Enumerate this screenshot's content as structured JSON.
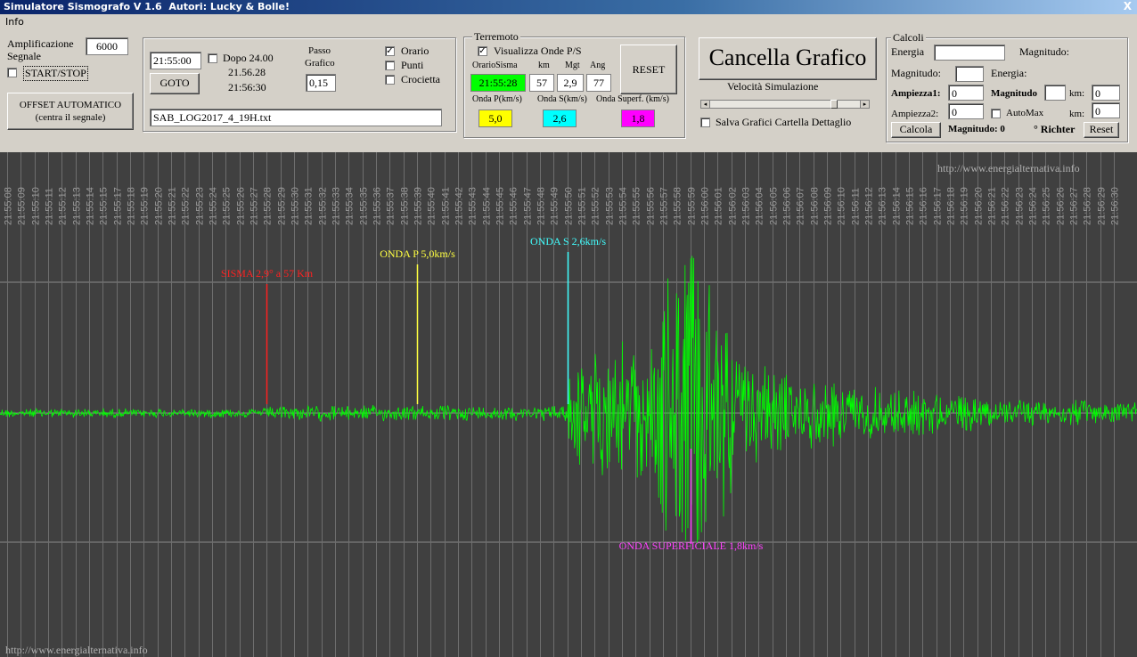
{
  "window": {
    "title": "Simulatore Sismografo V 1.6  Autori: Lucky & Bolle!",
    "close_glyph": "X"
  },
  "menu": {
    "info": "Info"
  },
  "left": {
    "amplification_label_1": "Amplificazione",
    "amplification_label_2": "Segnale",
    "amplification_value": "6000",
    "start_stop_label": "START/STOP",
    "offset_button_line1": "OFFSET AUTOMATICO",
    "offset_button_line2": "(centra il segnale)"
  },
  "time_panel": {
    "time_value": "21:55:00",
    "goto_label": "GOTO",
    "dopo_label": "Dopo 24.00",
    "time_a": "21.56.28",
    "time_b": "21:56:30",
    "passo_label_1": "Passo",
    "passo_label_2": "Grafico",
    "passo_value": "0,15",
    "orario_label": "Orario",
    "orario_checked": true,
    "punti_label": "Punti",
    "punti_checked": false,
    "crocietta_label": "Crocietta",
    "crocietta_checked": false,
    "filename": "SAB_LOG2017_4_19H.txt"
  },
  "terremoto": {
    "legend": "Terremoto",
    "visualizza_label": "Visualizza Onde P/S",
    "visualizza_checked": true,
    "reset_label": "RESET",
    "headers": [
      "OrarioSisma",
      "km",
      "Mgt",
      "Ang"
    ],
    "values": [
      "21:55:28",
      "57",
      "2,9",
      "77"
    ],
    "wave_labels": [
      "Onda P(km/s)",
      "Onda S(km/s)",
      "Onda Superf. (km/s)"
    ],
    "wave_values": [
      "5,0",
      "2,6",
      "1,8"
    ],
    "colors": {
      "orario": "#00ff00",
      "p": "#ffff00",
      "s": "#00ffff",
      "superf": "#ff00ff"
    }
  },
  "graph_controls": {
    "cancella_label": "Cancella Grafico",
    "speed_label": "Velocità Simulazione",
    "salva_label": "Salva Grafici Cartella Dettaglio",
    "salva_checked": false,
    "speed_fraction": 0.85
  },
  "calcoli": {
    "legend": "Calcoli",
    "energia_label": "Energia",
    "energia_value": "",
    "magnitudo_label": "Magnitudo:",
    "magnitudo2_label": "Magnitudo:",
    "magnitudo2_value": "",
    "energia2_label": "Energia:",
    "ampiezza1_label": "Ampiezza1:",
    "ampiezza1_value": "0",
    "magnitudo_bold_label": "Magnitudo",
    "magnitudo_bold_value": "",
    "km_label": "km:",
    "km1_value": "0",
    "ampiezza2_label": "Ampiezza2:",
    "ampiezza2_value": "0",
    "automax_label": "AutoMax",
    "automax_checked": false,
    "km2_value": "0",
    "calcola_label": "Calcola",
    "magnitudo_result": "Magnitudo: 0",
    "richter_label": "° Richter",
    "reset_label": "Reset"
  },
  "seismograph": {
    "watermark_top": "http://www.energialternativa.info",
    "watermark_bottom": "http://www.energialternativa.info",
    "time_labels": [
      "21:55:08",
      "21:55:09",
      "21:55:10",
      "21:55:11",
      "21:55:12",
      "21:55:13",
      "21:55:14",
      "21:55:15",
      "21:55:17",
      "21:55:18",
      "21:55:19",
      "21:55:20",
      "21:55:21",
      "21:55:22",
      "21:55:23",
      "21:55:24",
      "21:55:25",
      "21:55:26",
      "21:55:27",
      "21:55:28",
      "21:55:29",
      "21:55:30",
      "21:55:31",
      "21:55:32",
      "21:55:33",
      "21:55:34",
      "21:55:35",
      "21:55:36",
      "21:55:37",
      "21:55:38",
      "21:55:39",
      "21:55:40",
      "21:55:41",
      "21:55:42",
      "21:55:43",
      "21:55:44",
      "21:55:45",
      "21:55:46",
      "21:55:47",
      "21:55:48",
      "21:55:49",
      "21:55:50",
      "21:55:51",
      "21:55:52",
      "21:55:53",
      "21:55:54",
      "21:55:55",
      "21:55:56",
      "21:55:57",
      "21:55:58",
      "21:55:59",
      "21:56:00",
      "21:56:01",
      "21:56:02",
      "21:56:03",
      "21:56:04",
      "21:56:05",
      "21:56:06",
      "21:56:07",
      "21:56:08",
      "21:56:09",
      "21:56:10",
      "21:56:11",
      "21:56:12",
      "21:56:13",
      "21:56:14",
      "21:56:15",
      "21:56:16",
      "21:56:17",
      "21:56:18",
      "21:56:19",
      "21:56:20",
      "21:56:21",
      "21:56:22",
      "21:56:23",
      "21:56:24",
      "21:56:25",
      "21:56:26",
      "21:56:27",
      "21:56:28",
      "21:56:29",
      "21:56:30"
    ],
    "markers": [
      {
        "label": "SISMA 2,9° a 57 Km",
        "color": "#ff2020",
        "time": "21:55:28"
      },
      {
        "label": "ONDA P 5,0km/s",
        "color": "#ffff40",
        "time": "21:55:39"
      },
      {
        "label": "ONDA S 2,6km/s",
        "color": "#40ffff",
        "time": "21:55:50"
      },
      {
        "label": "ONDA SUPERFICIALE 1,8km/s",
        "color": "#ff40ff",
        "time": "21:55:59"
      }
    ],
    "trace_color": "#00ff00"
  }
}
